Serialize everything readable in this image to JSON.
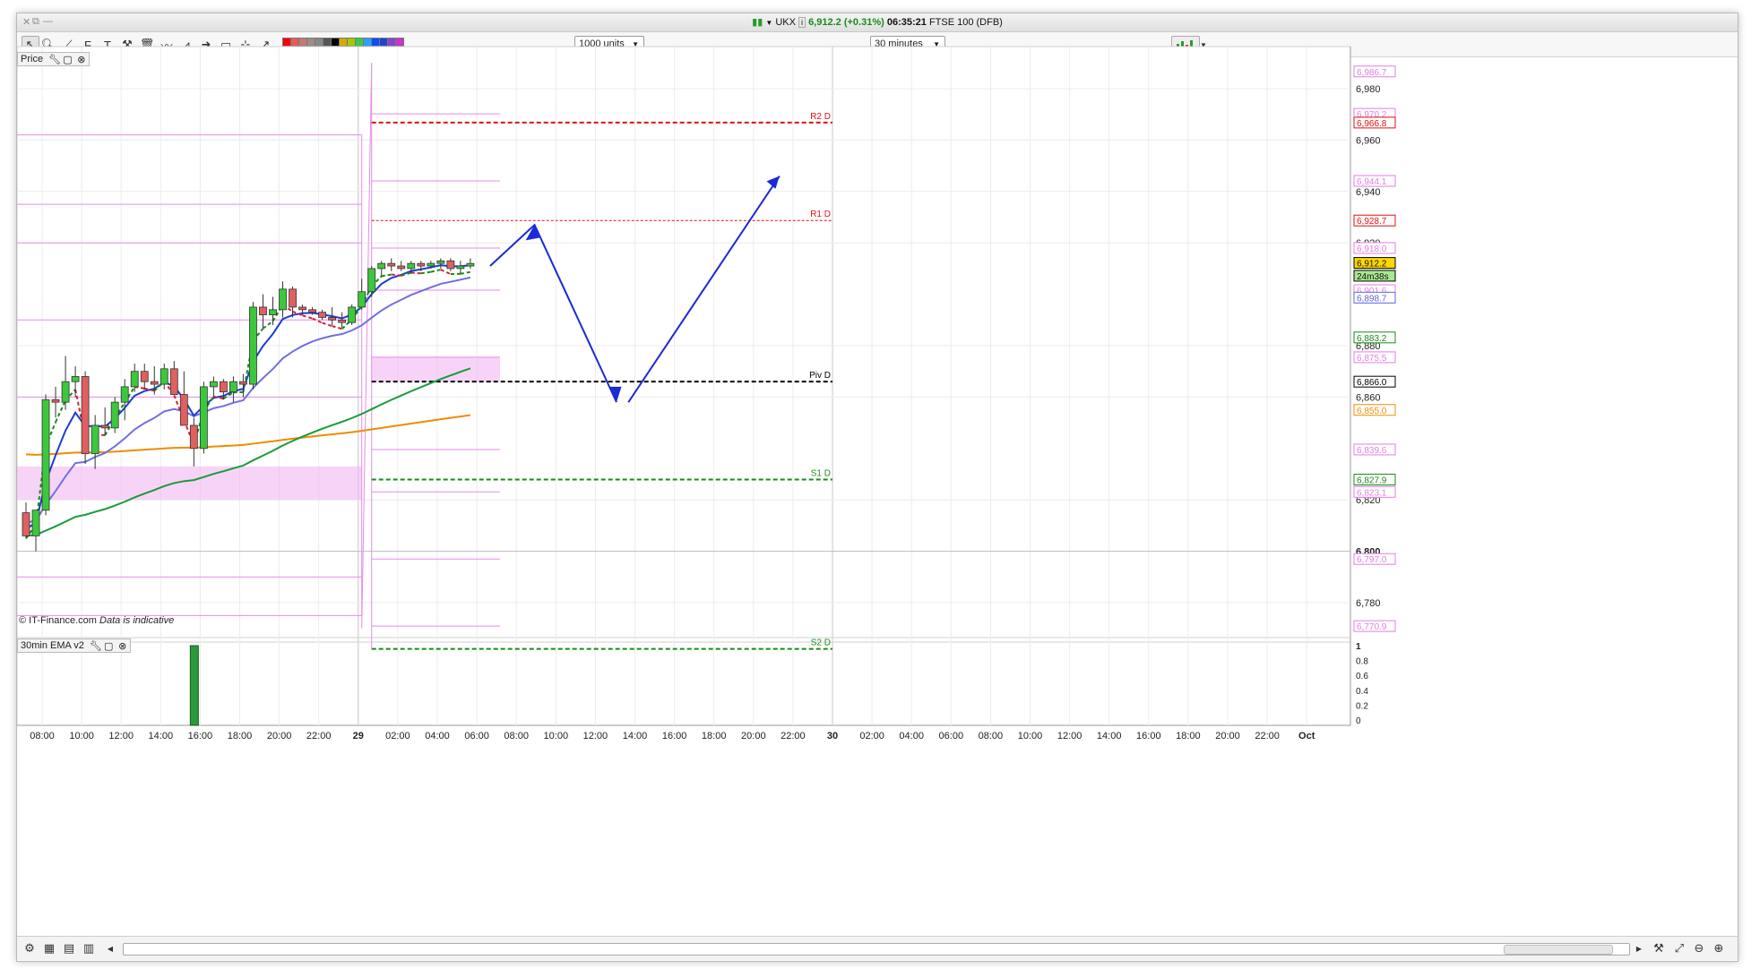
{
  "window": {
    "controls": [
      "✕",
      "⧉",
      "—"
    ],
    "title": {
      "symbol": "UKX",
      "price_change": "6,912.2 (+0.31%)",
      "time": "06:35:21",
      "market": "FTSE 100 (DFB)"
    }
  },
  "toolbar": {
    "tools": [
      "pointer-icon",
      "zoom-icon",
      "trendline-icon",
      "fibonacci-icon",
      "text-icon",
      "tools-icon",
      "delete-icon",
      "line-chart-icon",
      "zigzag-icon",
      "arrow-icon",
      "rectangle-icon",
      "crosshair-icon",
      "ray-icon"
    ],
    "swatches": [
      "#ff0000",
      "#e85a5a",
      "#c87878",
      "#a08a8a",
      "#888888",
      "#555555",
      "#000000",
      "#d4aa00",
      "#a8c800",
      "#3cc84a",
      "#2aa0ff",
      "#0a4cff",
      "#2244cc",
      "#8844cc",
      "#cc33cc"
    ],
    "units_select": "1000 units",
    "interval_select": "30 minutes",
    "chart_type_icon": "bar-chart-icon"
  },
  "price_panel": {
    "label": "Price",
    "copyright": "© IT-Finance.com",
    "disclaimer": "Data is indicative"
  },
  "indicator_panel": {
    "label": "30min EMA v2",
    "y_ticks": [
      "1",
      "0.8",
      "0.6",
      "0.4",
      "0.2",
      "0"
    ]
  },
  "bottom": {
    "icons": [
      "chart-settings-icon",
      "layout-icon",
      "template-icon",
      "indicators-icon",
      "scroll-left-icon",
      "scroll-right-icon",
      "chart-tools-icon",
      "zoom-fit-icon",
      "zoom-out-icon",
      "zoom-in-icon"
    ]
  },
  "chart_data": {
    "type": "candlestick",
    "instrument": "UKX",
    "interval": "30 minutes",
    "y_ticks": [
      6980,
      6960,
      6940,
      6920,
      6880,
      6860,
      6820,
      6800,
      6780
    ],
    "y_tick_labels": [
      "6,980",
      "6,960",
      "6,940",
      "6,920",
      "6,880",
      "6,860",
      "6,820",
      "6,800",
      "6,780"
    ],
    "y_range": [
      6762,
      6995
    ],
    "x_tick_labels": [
      "08:00",
      "10:00",
      "12:00",
      "14:00",
      "16:00",
      "18:00",
      "20:00",
      "22:00",
      "29",
      "02:00",
      "04:00",
      "06:00",
      "08:00",
      "10:00",
      "12:00",
      "14:00",
      "16:00",
      "18:00",
      "20:00",
      "22:00",
      "30",
      "02:00",
      "04:00",
      "06:00",
      "08:00",
      "10:00",
      "12:00",
      "14:00",
      "16:00",
      "18:00",
      "20:00",
      "22:00",
      "Oct"
    ],
    "candles": [
      {
        "o": 6815,
        "h": 6819,
        "l": 6805,
        "c": 6806
      },
      {
        "o": 6806,
        "h": 6815,
        "l": 6800,
        "c": 6816
      },
      {
        "o": 6816,
        "h": 6861,
        "l": 6814,
        "c": 6859
      },
      {
        "o": 6859,
        "h": 6864,
        "l": 6852,
        "c": 6858
      },
      {
        "o": 6858,
        "h": 6876,
        "l": 6855,
        "c": 6866
      },
      {
        "o": 6866,
        "h": 6872,
        "l": 6860,
        "c": 6868
      },
      {
        "o": 6868,
        "h": 6870,
        "l": 6834,
        "c": 6838
      },
      {
        "o": 6838,
        "h": 6853,
        "l": 6832,
        "c": 6849
      },
      {
        "o": 6849,
        "h": 6856,
        "l": 6845,
        "c": 6848
      },
      {
        "o": 6848,
        "h": 6860,
        "l": 6846,
        "c": 6858
      },
      {
        "o": 6858,
        "h": 6867,
        "l": 6851,
        "c": 6864
      },
      {
        "o": 6864,
        "h": 6873,
        "l": 6862,
        "c": 6870
      },
      {
        "o": 6870,
        "h": 6873,
        "l": 6863,
        "c": 6866
      },
      {
        "o": 6866,
        "h": 6872,
        "l": 6861,
        "c": 6865
      },
      {
        "o": 6865,
        "h": 6873,
        "l": 6863,
        "c": 6871
      },
      {
        "o": 6871,
        "h": 6874,
        "l": 6864,
        "c": 6861
      },
      {
        "o": 6861,
        "h": 6870,
        "l": 6850,
        "c": 6849
      },
      {
        "o": 6849,
        "h": 6852,
        "l": 6833,
        "c": 6840
      },
      {
        "o": 6840,
        "h": 6866,
        "l": 6838,
        "c": 6864
      },
      {
        "o": 6864,
        "h": 6868,
        "l": 6860,
        "c": 6866
      },
      {
        "o": 6866,
        "h": 6867,
        "l": 6859,
        "c": 6862
      },
      {
        "o": 6862,
        "h": 6868,
        "l": 6858,
        "c": 6866
      },
      {
        "o": 6866,
        "h": 6869,
        "l": 6860,
        "c": 6865
      },
      {
        "o": 6865,
        "h": 6897,
        "l": 6863,
        "c": 6895
      },
      {
        "o": 6895,
        "h": 6900,
        "l": 6887,
        "c": 6892
      },
      {
        "o": 6892,
        "h": 6899,
        "l": 6888,
        "c": 6894
      },
      {
        "o": 6894,
        "h": 6905,
        "l": 6891,
        "c": 6902
      },
      {
        "o": 6902,
        "h": 6903,
        "l": 6891,
        "c": 6895
      },
      {
        "o": 6895,
        "h": 6896,
        "l": 6892,
        "c": 6894
      },
      {
        "o": 6894,
        "h": 6895,
        "l": 6892,
        "c": 6893
      },
      {
        "o": 6893,
        "h": 6894,
        "l": 6890,
        "c": 6891
      },
      {
        "o": 6891,
        "h": 6895,
        "l": 6888,
        "c": 6890
      },
      {
        "o": 6890,
        "h": 6893,
        "l": 6887,
        "c": 6889
      },
      {
        "o": 6889,
        "h": 6896,
        "l": 6888,
        "c": 6895
      },
      {
        "o": 6895,
        "h": 6906,
        "l": 6894,
        "c": 6901
      },
      {
        "o": 6901,
        "h": 6911,
        "l": 6899,
        "c": 6910
      },
      {
        "o": 6910,
        "h": 6913,
        "l": 6907,
        "c": 6912
      },
      {
        "o": 6912,
        "h": 6914,
        "l": 6909,
        "c": 6911
      },
      {
        "o": 6911,
        "h": 6913,
        "l": 6909,
        "c": 6910
      },
      {
        "o": 6910,
        "h": 6913,
        "l": 6908,
        "c": 6912
      },
      {
        "o": 6912,
        "h": 6913,
        "l": 6909,
        "c": 6911
      },
      {
        "o": 6911,
        "h": 6913,
        "l": 6910,
        "c": 6912
      },
      {
        "o": 6912,
        "h": 6914,
        "l": 6910,
        "c": 6913
      },
      {
        "o": 6913,
        "h": 6914,
        "l": 6909,
        "c": 6910
      },
      {
        "o": 6910,
        "h": 6913,
        "l": 6908,
        "c": 6911
      },
      {
        "o": 6911,
        "h": 6914,
        "l": 6910,
        "c": 6912
      }
    ],
    "pivot_levels": [
      {
        "name": "R2 D",
        "value": 6966.8,
        "color": "#e01010",
        "style": "dashed"
      },
      {
        "name": "R1 D",
        "value": 6928.7,
        "color": "#e01010",
        "style": "dotted"
      },
      {
        "name": "Piv D",
        "value": 6866.0,
        "color": "#000000",
        "style": "dashed"
      },
      {
        "name": "S1 D",
        "value": 6827.9,
        "color": "#1a8a1a",
        "style": "dashed"
      },
      {
        "name": "S2 D",
        "value": 6762.0,
        "color": "#1a8a1a",
        "style": "dashed"
      }
    ],
    "axis_markers": [
      {
        "label": "6,986.7",
        "value": 6986.7,
        "color": "#e080e0"
      },
      {
        "label": "6,970.2",
        "value": 6970.2,
        "color": "#e080e0"
      },
      {
        "label": "6,966.8",
        "value": 6966.8,
        "color": "#e01010"
      },
      {
        "label": "6,944.1",
        "value": 6944.1,
        "color": "#e080e0"
      },
      {
        "label": "6,928.7",
        "value": 6928.7,
        "color": "#e01010"
      },
      {
        "label": "6,918.0",
        "value": 6918.0,
        "color": "#e080e0"
      },
      {
        "label": "6,912.2",
        "value": 6912.2,
        "color": "#000000",
        "bg": "#ffd700"
      },
      {
        "label": "24m38s",
        "value": 6907.2,
        "color": "#000000",
        "bg": "#a8e890"
      },
      {
        "label": "6,901.6",
        "value": 6901.6,
        "color": "#e080e0"
      },
      {
        "label": "6,898.7",
        "value": 6898.7,
        "color": "#6060e0"
      },
      {
        "label": "6,883.2",
        "value": 6883.2,
        "color": "#1a8a1a"
      },
      {
        "label": "6,875.5",
        "value": 6875.5,
        "color": "#e080e0"
      },
      {
        "label": "6,866.0",
        "value": 6866.0,
        "color": "#000000"
      },
      {
        "label": "6,855.0",
        "value": 6855.0,
        "color": "#f08c00"
      },
      {
        "label": "6,839.6",
        "value": 6839.6,
        "color": "#e080e0"
      },
      {
        "label": "6,827.9",
        "value": 6827.9,
        "color": "#1a8a1a"
      },
      {
        "label": "6,823.1",
        "value": 6823.1,
        "color": "#e080e0"
      },
      {
        "label": "6,797.0",
        "value": 6797.0,
        "color": "#e080e0"
      },
      {
        "label": "6,770.9",
        "value": 6770.9,
        "color": "#e080e0"
      }
    ],
    "indicator_bars": [
      {
        "index": 17,
        "value": 1
      }
    ],
    "colors": {
      "up": "#3cc83c",
      "down": "#e06060",
      "ema_fast": "#1c3ccf",
      "ema_mid": "#7070e0",
      "ema_slow": "#1a9a3a",
      "ema_long": "#f08c00",
      "psar": "#1a8a1a",
      "band": "#f0b0f0",
      "arrow": "#1a2ad8"
    }
  }
}
